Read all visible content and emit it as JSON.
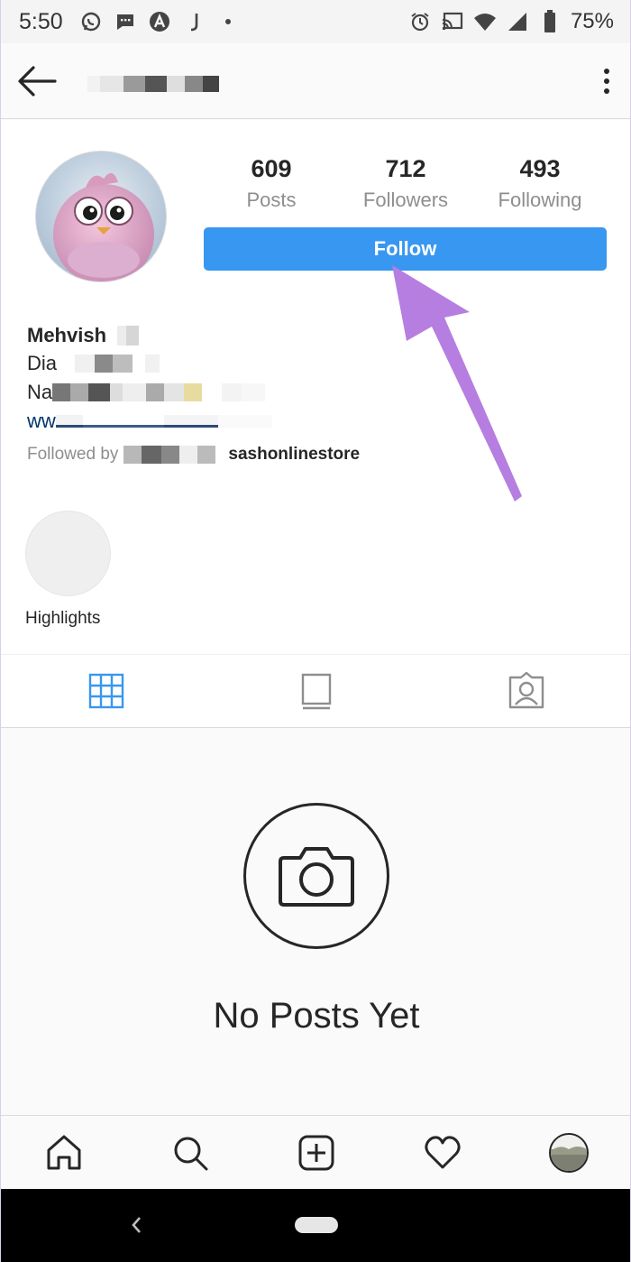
{
  "status_bar": {
    "time": "5:50",
    "battery": "75%",
    "icons": [
      "whatsapp-icon",
      "message-icon",
      "arc-icon",
      "j-icon",
      "dot-icon",
      "alarm-icon",
      "cast-icon",
      "wifi-icon",
      "signal-icon",
      "battery-icon"
    ]
  },
  "appbar": {
    "back_icon": "arrow-left-icon",
    "more_icon": "vertical-dots-icon"
  },
  "profile": {
    "stats": [
      {
        "value": "609",
        "label": "Posts"
      },
      {
        "value": "712",
        "label": "Followers"
      },
      {
        "value": "493",
        "label": "Following"
      }
    ],
    "follow_label": "Follow",
    "name": "Mehvish",
    "bio_line_1": "Dia",
    "bio_line_2": "Na",
    "bio_link": "ww",
    "followed_by_label": "Followed by",
    "followed_by_account": "sashonlinestore",
    "highlight_label": "Highlights"
  },
  "tabs": [
    {
      "name": "grid",
      "icon": "grid-icon",
      "active": true
    },
    {
      "name": "feed",
      "icon": "feed-icon",
      "active": false
    },
    {
      "name": "tagged",
      "icon": "tagged-icon",
      "active": false
    }
  ],
  "empty_state": {
    "icon": "camera-icon",
    "title": "No Posts Yet"
  },
  "bottom_nav": [
    {
      "name": "home",
      "icon": "home-icon"
    },
    {
      "name": "search",
      "icon": "search-icon"
    },
    {
      "name": "new-post",
      "icon": "add-post-icon"
    },
    {
      "name": "activity",
      "icon": "heart-icon"
    },
    {
      "name": "profile",
      "icon": "profile-avatar"
    }
  ],
  "colors": {
    "accent_blue": "#3897f0",
    "annotation_arrow": "#b57ee0",
    "link_dark_blue": "#003569"
  }
}
